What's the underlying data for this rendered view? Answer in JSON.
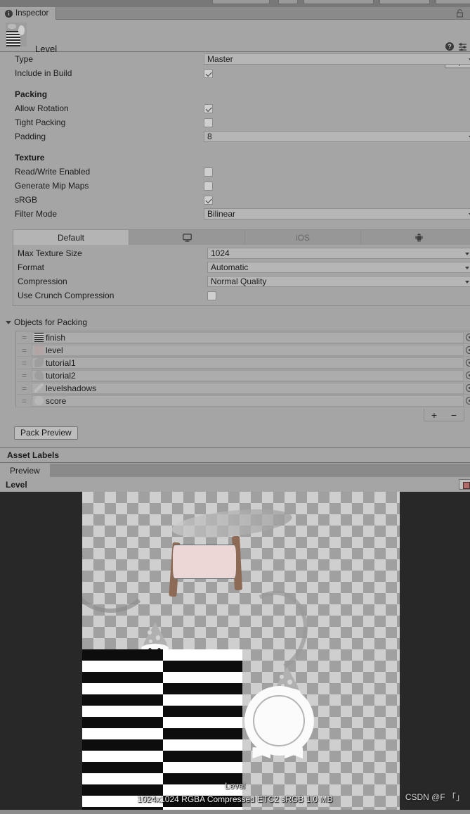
{
  "window": {
    "tab_label": "Inspector",
    "info_icon": "info-icon",
    "lock_icon": "lock-icon"
  },
  "asset_header": {
    "name": "Level",
    "help_icon": "help-icon",
    "preset_icon": "preset-icon",
    "open_button": "Open"
  },
  "properties": [
    {
      "label": "Type",
      "kind": "dropdown",
      "value": "Master"
    },
    {
      "label": "Include in Build",
      "kind": "checkbox",
      "checked": true
    }
  ],
  "packing": {
    "section_title": "Packing",
    "rows": [
      {
        "label": "Allow Rotation",
        "kind": "checkbox",
        "checked": true
      },
      {
        "label": "Tight Packing",
        "kind": "checkbox",
        "checked": false
      },
      {
        "label": "Padding",
        "kind": "dropdown",
        "value": "8"
      }
    ]
  },
  "texture": {
    "section_title": "Texture",
    "rows": [
      {
        "label": "Read/Write Enabled",
        "kind": "checkbox",
        "checked": false
      },
      {
        "label": "Generate Mip Maps",
        "kind": "checkbox",
        "checked": false
      },
      {
        "label": "sRGB",
        "kind": "checkbox",
        "checked": true
      },
      {
        "label": "Filter Mode",
        "kind": "dropdown",
        "value": "Bilinear"
      }
    ]
  },
  "platform_tabs": [
    {
      "label": "Default",
      "icon": "",
      "active": true
    },
    {
      "label": "",
      "icon": "monitor-icon",
      "active": false
    },
    {
      "label": "iOS",
      "icon": "",
      "active": false
    },
    {
      "label": "",
      "icon": "android-icon",
      "active": false
    }
  ],
  "platform_settings": [
    {
      "label": "Max Texture Size",
      "kind": "dropdown",
      "value": "1024"
    },
    {
      "label": "Format",
      "kind": "dropdown",
      "value": "Automatic"
    },
    {
      "label": "Compression",
      "kind": "dropdown",
      "value": "Normal Quality"
    },
    {
      "label": "Use Crunch Compression",
      "kind": "checkbox",
      "checked": false
    }
  ],
  "objects_for_packing": {
    "title": "Objects for Packing",
    "expanded": true,
    "items": [
      {
        "name": "finish",
        "thumb": "st-finish"
      },
      {
        "name": "level",
        "thumb": "st-level"
      },
      {
        "name": "tutorial1",
        "thumb": "st-t1"
      },
      {
        "name": "tutorial2",
        "thumb": "st-t2"
      },
      {
        "name": "levelshadows",
        "thumb": "st-shadow"
      },
      {
        "name": "score",
        "thumb": "st-score"
      }
    ],
    "add_button": "+",
    "remove_button": "−"
  },
  "pack_preview_button": "Pack Preview",
  "asset_labels": {
    "title": "Asset Labels"
  },
  "preview": {
    "tab_label": "Preview",
    "title": "Level",
    "overlay_title": "Level",
    "overlay_info": "1024x1024 RGBA Compressed ETC2 sRGB   1.0 MB",
    "watermark": "CSDN @F 「」"
  },
  "colors": {
    "panel_bg": "#a5a5a5",
    "tabbar_bg": "#8a8a8a",
    "field_bg": "#b6b6b6",
    "preview_bg": "#282828",
    "checker_light": "#cfcfcf",
    "checker_dark": "#a0a0a0"
  }
}
